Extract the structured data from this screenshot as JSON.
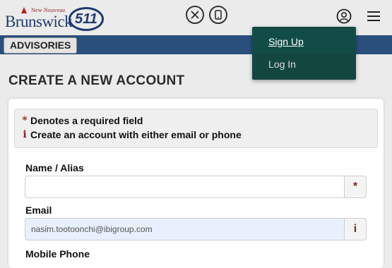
{
  "header": {
    "logo": {
      "small_text": "New Nouveau",
      "name": "Brunswick",
      "badge": "511"
    },
    "social": {
      "x_icon": "x-logo-icon",
      "phone_icon": "mobile-phone-icon"
    },
    "account_icon": "user-circle-icon",
    "menu_icon": "hamburger-menu-icon"
  },
  "nav": {
    "advisories_label": "ADVISORIES"
  },
  "account_menu": {
    "items": [
      {
        "label": "Sign Up",
        "active": true
      },
      {
        "label": "Log In",
        "active": false
      }
    ]
  },
  "page": {
    "title": "CREATE A NEW ACCOUNT"
  },
  "notice": {
    "required_text": "Denotes a required field",
    "required_icon": "*",
    "info_text": "Create an account with either email or phone",
    "info_icon": "i"
  },
  "form": {
    "name": {
      "label": "Name / Alias",
      "value": "",
      "addon": "*"
    },
    "email": {
      "label": "Email",
      "value": "nasim.tootoonchi@ibigroup.com",
      "addon": "i"
    },
    "phone": {
      "label": "Mobile Phone"
    }
  },
  "colors": {
    "nav_bar": "#2a4f7c",
    "dropdown_bg": "#144640",
    "required_marker": "#8a1f1f",
    "autofill_bg": "#e8f0fe"
  }
}
